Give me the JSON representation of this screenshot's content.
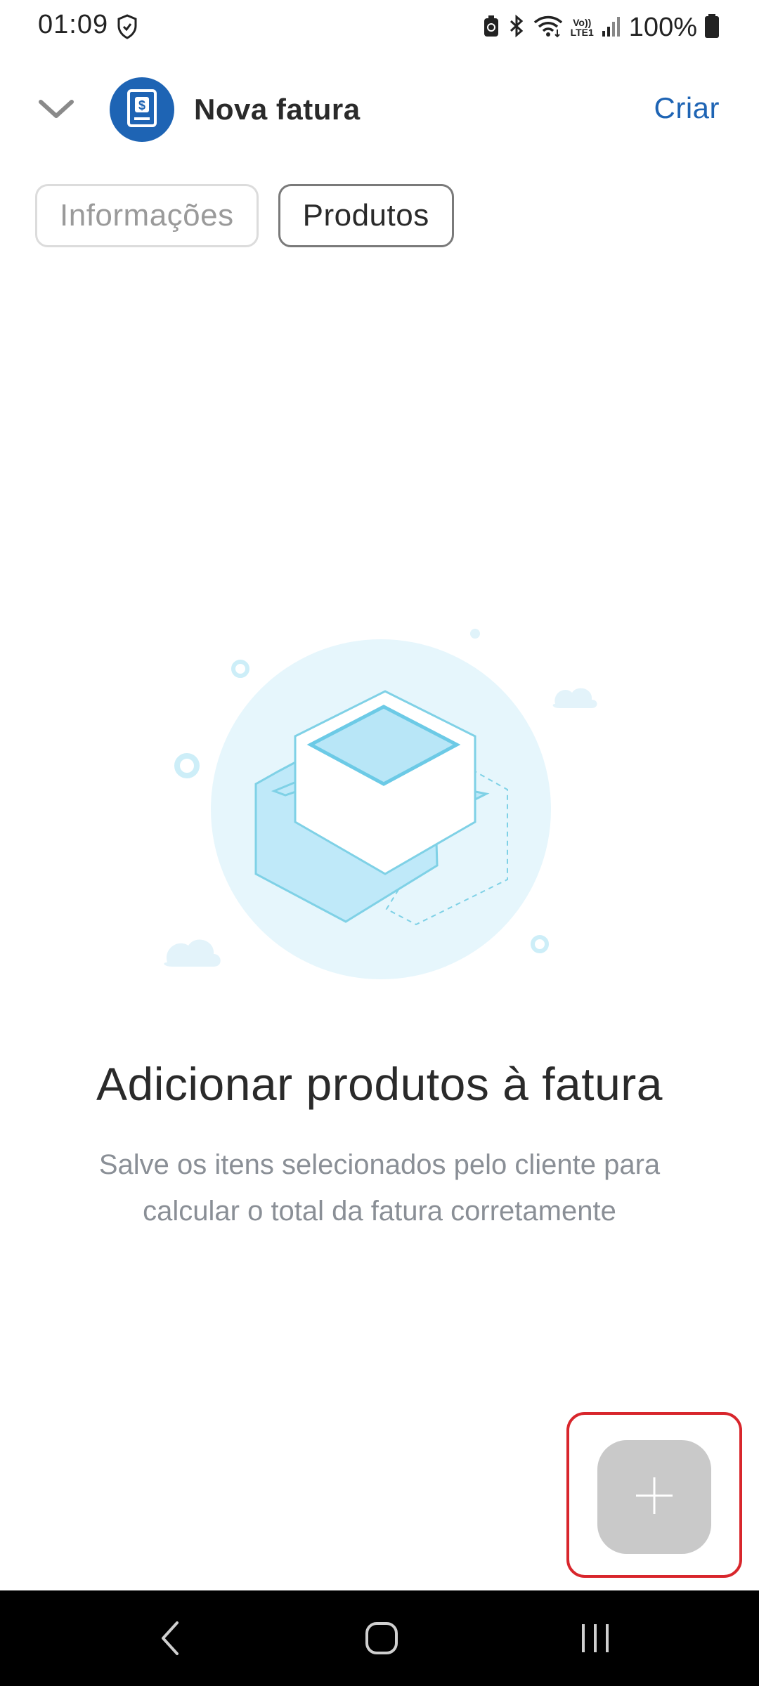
{
  "status_bar": {
    "time": "01:09",
    "battery_text": "100%",
    "network_label_top": "Vo))",
    "network_label_bottom": "LTE1",
    "icons": [
      "shield-icon",
      "battery-saver-icon",
      "bluetooth-icon",
      "wifi-icon",
      "signal-icon",
      "battery-icon"
    ]
  },
  "header": {
    "title": "Nova fatura",
    "create_label": "Criar",
    "collapse_icon": "chevron-down-icon",
    "avatar_icon": "invoice-dollar-icon"
  },
  "tabs": [
    {
      "label": "Informações",
      "active": false
    },
    {
      "label": "Produtos",
      "active": true
    }
  ],
  "empty_state": {
    "illustration": "product-box-illustration",
    "title": "Adicionar produtos à fatura",
    "subtitle_line1": "Salve os itens selecionados pelo cliente para",
    "subtitle_line2": "calcular o total da fatura corretamente"
  },
  "fab": {
    "icon": "plus-icon",
    "highlight_color": "#d8262c"
  },
  "nav_bar": {
    "icons": [
      "back-icon",
      "home-icon",
      "recent-apps-icon"
    ]
  },
  "colors": {
    "accent": "#1e64b4",
    "fab_background": "#c9c9c9",
    "subtitle_text": "#8a8f96"
  }
}
